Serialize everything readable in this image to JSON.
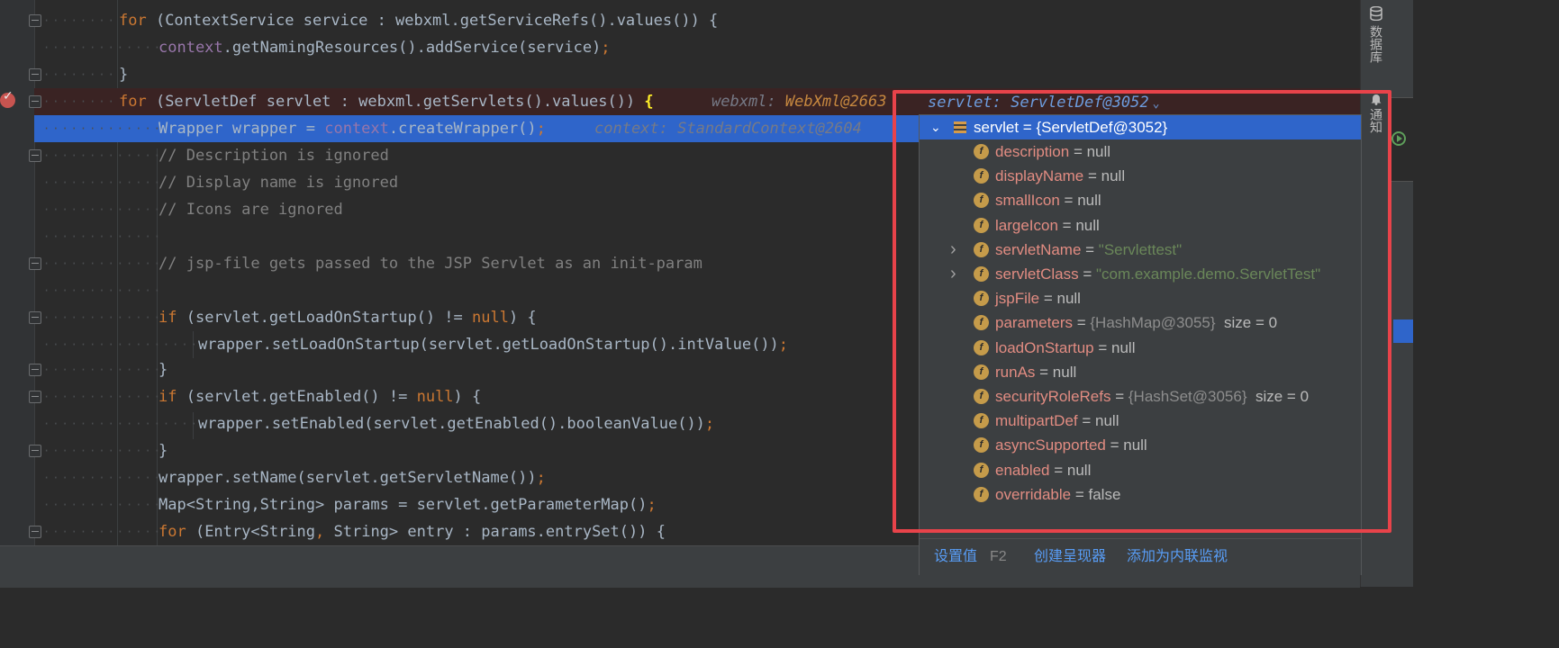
{
  "editor": {
    "lines": [
      {
        "name": "line-for-service-refs",
        "html": "<span class=\"kw\">for</span> (ContextService service : webxml.getServiceRefs().values()) {"
      },
      {
        "name": "line-add-service",
        "html": "<span class=\"fld\">context</span>.getNamingResources().addService(service)<span class=\"semi\">;</span>"
      },
      {
        "name": "line-close-brace-1",
        "html": "}"
      },
      {
        "name": "line-for-servlets",
        "html": "<span class=\"kw\">for</span> (ServletDef servlet : webxml.getServlets().values()) <span class=\"brace-hl\">{</span>"
      },
      {
        "name": "line-create-wrapper",
        "html": "Wrapper wrapper = <span class=\"fld\">context</span>.createWrapper()<span class=\"semi\">;</span>"
      },
      {
        "name": "line-comment-description",
        "html": "<span class=\"cmt\">// Description is ignored</span>"
      },
      {
        "name": "line-comment-display-name",
        "html": "<span class=\"cmt\">// Display name is ignored</span>"
      },
      {
        "name": "line-comment-icons",
        "html": "<span class=\"cmt\">// Icons are ignored</span>"
      },
      {
        "name": "line-blank-1",
        "html": ""
      },
      {
        "name": "line-comment-jsp-file",
        "html": "<span class=\"cmt\">// jsp-file gets passed to the JSP Servlet as an init-param</span>"
      },
      {
        "name": "line-blank-2",
        "html": ""
      },
      {
        "name": "line-if-load-on-startup",
        "html": "<span class=\"kw\">if</span> (servlet.getLoadOnStartup() != <span class=\"kw\">null</span>) {"
      },
      {
        "name": "line-set-load-on-startup",
        "html": "wrapper.setLoadOnStartup(servlet.getLoadOnStartup().intValue())<span class=\"semi\">;</span>"
      },
      {
        "name": "line-close-brace-2",
        "html": "}"
      },
      {
        "name": "line-if-enabled",
        "html": "<span class=\"kw\">if</span> (servlet.getEnabled() != <span class=\"kw\">null</span>) {"
      },
      {
        "name": "line-set-enabled",
        "html": "wrapper.setEnabled(servlet.getEnabled().booleanValue())<span class=\"semi\">;</span>"
      },
      {
        "name": "line-close-brace-3",
        "html": "}"
      },
      {
        "name": "line-set-name",
        "html": "wrapper.setName(servlet.getServletName())<span class=\"semi\">;</span>"
      },
      {
        "name": "line-get-params",
        "html": "Map&lt;String,String&gt; params = servlet.getParameterMap()<span class=\"semi\">;</span>"
      },
      {
        "name": "line-for-entry",
        "html": "<span class=\"kw\">for</span> (Entry&lt;String<span class=\"semi\">,</span> String&gt; entry : params.entrySet()) {"
      }
    ],
    "inline_webxml_label": "webxml:",
    "inline_webxml_value": "WebXml@2663",
    "inline_context": "context: StandardContext@2604"
  },
  "popup": {
    "header": "servlet: ServletDef@3052",
    "root_label": "servlet = {ServletDef@3052}",
    "fields": [
      {
        "name": "description",
        "eq": " = ",
        "value": "null",
        "kind": "null",
        "size": ""
      },
      {
        "name": "displayName",
        "eq": " = ",
        "value": "null",
        "kind": "null",
        "size": ""
      },
      {
        "name": "smallIcon",
        "eq": " = ",
        "value": "null",
        "kind": "null",
        "size": ""
      },
      {
        "name": "largeIcon",
        "eq": " = ",
        "value": "null",
        "kind": "null",
        "size": ""
      },
      {
        "name": "servletName",
        "eq": " = ",
        "value": "\"Servlettest\"",
        "kind": "str",
        "size": ""
      },
      {
        "name": "servletClass",
        "eq": " = ",
        "value": "\"com.example.demo.ServletTest\"",
        "kind": "str",
        "size": ""
      },
      {
        "name": "jspFile",
        "eq": " = ",
        "value": "null",
        "kind": "null",
        "size": ""
      },
      {
        "name": "parameters",
        "eq": " = ",
        "value": "{HashMap@3055}",
        "kind": "ref",
        "size": "size = 0"
      },
      {
        "name": "loadOnStartup",
        "eq": " = ",
        "value": "null",
        "kind": "null",
        "size": ""
      },
      {
        "name": "runAs",
        "eq": " = ",
        "value": "null",
        "kind": "null",
        "size": ""
      },
      {
        "name": "securityRoleRefs",
        "eq": " = ",
        "value": "{HashSet@3056}",
        "kind": "ref",
        "size": "size = 0"
      },
      {
        "name": "multipartDef",
        "eq": " = ",
        "value": "null",
        "kind": "null",
        "size": ""
      },
      {
        "name": "asyncSupported",
        "eq": " = ",
        "value": "null",
        "kind": "null",
        "size": ""
      },
      {
        "name": "enabled",
        "eq": " = ",
        "value": "null",
        "kind": "null",
        "size": ""
      },
      {
        "name": "overridable",
        "eq": " = ",
        "value": "false",
        "kind": "null",
        "size": ""
      }
    ],
    "footer": {
      "set_value": "设置值",
      "set_value_key": "F2",
      "create_renderer": "创建呈现器",
      "add_inline_watch": "添加为内联监视"
    }
  },
  "right_stripe": {
    "database": "数据库",
    "notifications": "通知"
  },
  "icons": {
    "field": "f",
    "database": "database-icon",
    "bell": "bell-icon"
  }
}
